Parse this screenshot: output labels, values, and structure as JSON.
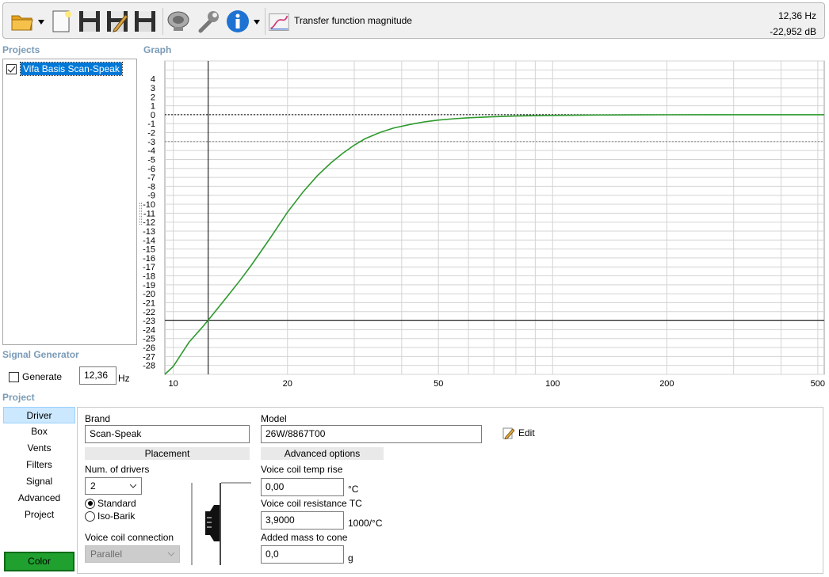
{
  "toolbar": {
    "title": "Transfer function magnitude",
    "readout_freq": "12,36 Hz",
    "readout_level": "-22,952 dB",
    "icons": [
      "open-folder-icon",
      "new-document-icon",
      "save-icon",
      "save-as-icon",
      "save-all-icon",
      "speaker-icon",
      "settings-wrench-icon",
      "info-icon",
      "graph-icon"
    ]
  },
  "projects": {
    "title": "Projects",
    "items": [
      {
        "label": "Vifa Basis Scan-Speak",
        "checked": true
      }
    ]
  },
  "graph": {
    "title": "Graph"
  },
  "signal_generator": {
    "title": "Signal Generator",
    "generate_label": "Generate",
    "frequency": "12,36",
    "unit": "Hz"
  },
  "project": {
    "title": "Project",
    "tabs": [
      "Driver",
      "Box",
      "Vents",
      "Filters",
      "Signal",
      "Advanced",
      "Project"
    ],
    "active_tab": "Driver",
    "color_label": "Color",
    "color_value": "#1fa02f"
  },
  "driver": {
    "brand_label": "Brand",
    "brand": "Scan-Speak",
    "model_label": "Model",
    "model": "26W/8867T00",
    "edit_label": "Edit",
    "placement_header": "Placement",
    "num_drivers_label": "Num. of drivers",
    "num_drivers": "2",
    "radio_standard": "Standard",
    "radio_isobarik": "Iso-Barik",
    "voice_coil_connection_label": "Voice coil connection",
    "voice_coil_connection": "Parallel",
    "advanced_header": "Advanced options",
    "temp_rise_label": "Voice coil temp rise",
    "temp_rise": "0,00",
    "temp_rise_unit": "°C",
    "resistance_tc_label": "Voice coil resistance TC",
    "resistance_tc": "3,9000",
    "resistance_tc_unit": "1000/°C",
    "added_mass_label": "Added mass to cone",
    "added_mass": "0,0",
    "added_mass_unit": "g"
  },
  "chart_data": {
    "type": "line",
    "x_scale": "log",
    "xlim": [
      9.5,
      520
    ],
    "ylim": [
      -29,
      6
    ],
    "x_ticks": [
      10,
      20,
      50,
      100,
      200,
      500
    ],
    "y_ticks": [
      4,
      3,
      2,
      1,
      0,
      -1,
      -2,
      -3,
      -4,
      -5,
      -6,
      -7,
      -8,
      -9,
      -10,
      -11,
      -12,
      -13,
      -14,
      -15,
      -16,
      -17,
      -18,
      -19,
      -20,
      -21,
      -22,
      -23,
      -24,
      -25,
      -26,
      -27,
      -28
    ],
    "reference_lines": [
      0,
      -3
    ],
    "cursor": {
      "x": 12.36,
      "y": -22.952
    },
    "grid": true,
    "line_color": "#2c9a2c",
    "series": [
      {
        "x": [
          9.5,
          10,
          11,
          12,
          12.36,
          13,
          14,
          15,
          16,
          17,
          18,
          19,
          20,
          22,
          24,
          26,
          28,
          30,
          32,
          35,
          38,
          42,
          46,
          50,
          55,
          60,
          70,
          80,
          100,
          130,
          170,
          200,
          300,
          400,
          520
        ],
        "y": [
          -29.2,
          -28.1,
          -25.4,
          -23.6,
          -22.95,
          -21.8,
          -20.1,
          -18.5,
          -16.9,
          -15.3,
          -13.8,
          -12.3,
          -10.9,
          -8.6,
          -6.8,
          -5.4,
          -4.3,
          -3.4,
          -2.7,
          -2.0,
          -1.5,
          -1.1,
          -0.8,
          -0.6,
          -0.45,
          -0.35,
          -0.22,
          -0.15,
          -0.08,
          -0.04,
          -0.02,
          -0.01,
          0,
          0,
          0
        ]
      }
    ]
  }
}
